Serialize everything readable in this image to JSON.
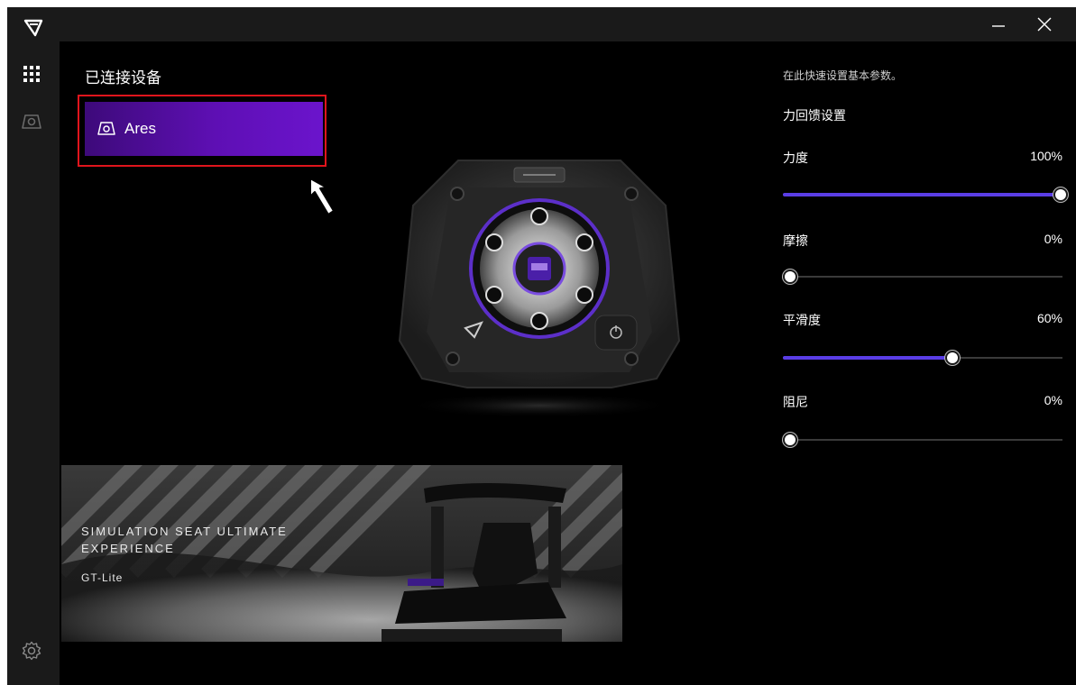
{
  "window": {
    "minimize_icon": "minimize-icon",
    "close_icon": "close-icon"
  },
  "sidebar": {
    "logo_icon": "brand-logo-icon",
    "items": [
      {
        "icon": "grid-icon"
      },
      {
        "icon": "device-icon"
      }
    ],
    "settings_icon": "gear-icon"
  },
  "main": {
    "title": "已连接设备",
    "devices": [
      {
        "label": "Ares",
        "icon": "device-icon"
      }
    ],
    "banner": {
      "title": "SIMULATION SEAT  ULTIMATE EXPERIENCE",
      "subtitle": "GT-Lite"
    }
  },
  "settings_panel": {
    "intro": "在此快速设置基本参数。",
    "section_title": "力回馈设置",
    "sliders": [
      {
        "label": "力度",
        "value_text": "100%",
        "level": 1.0
      },
      {
        "label": "摩擦",
        "value_text": "0%",
        "level": 0.0
      },
      {
        "label": "平滑度",
        "value_text": "60%",
        "level": 0.6
      },
      {
        "label": "阻尼",
        "value_text": "0%",
        "level": 0.0
      }
    ]
  },
  "colors": {
    "accent": "#5a3de6",
    "card_start": "#3d0a7a",
    "card_end": "#6b14cc",
    "highlight": "#e0141c"
  }
}
